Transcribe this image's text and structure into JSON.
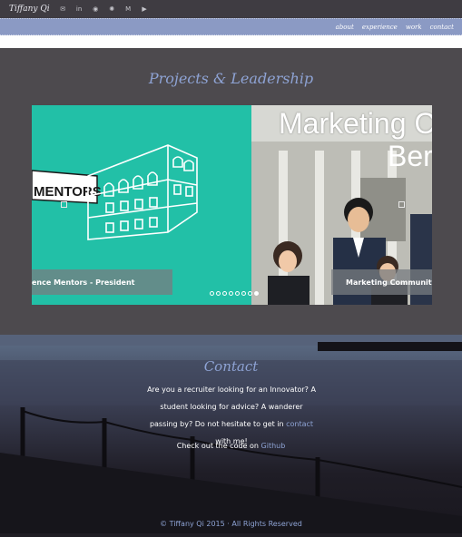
{
  "header": {
    "brand": "Tiffany Qi",
    "social": [
      {
        "icon": "email-icon",
        "glyph": "✉"
      },
      {
        "icon": "linkedin-icon",
        "glyph": "in"
      },
      {
        "icon": "github-icon",
        "glyph": "◉"
      },
      {
        "icon": "dribbble-icon",
        "glyph": "✺"
      },
      {
        "icon": "medium-icon",
        "glyph": "M"
      },
      {
        "icon": "youtube-icon",
        "glyph": "▶"
      }
    ]
  },
  "nav": {
    "about": "about",
    "experience": "experience",
    "work": "work",
    "contact": "contact"
  },
  "projects": {
    "title": "Projects & Leadership",
    "slides": {
      "left_caption": "ence Mentors - President",
      "left_banner": "MENTORS",
      "right_headline_1": "Marketing C",
      "right_headline_2": "Ber",
      "right_caption": "Marketing Community at"
    },
    "dots_total": 8,
    "dots_active_index": 7
  },
  "contact": {
    "title": "Contact",
    "line_pre": "Are you a recruiter looking for an Innovator? A student looking for advice? A wanderer passing by? Do not hesitate to get in ",
    "contact_link": "contact",
    "line_post": " with me!",
    "code_pre": "Check out the code on ",
    "github_link": "Github"
  },
  "footer": {
    "text": "© Tiffany Qi 2015 · All Rights Reserved"
  },
  "colors": {
    "accent": "#8ea3d4",
    "navbar": "#8b9ac4",
    "teal": "#22c0a7",
    "overlay": "#4d4a4e"
  }
}
